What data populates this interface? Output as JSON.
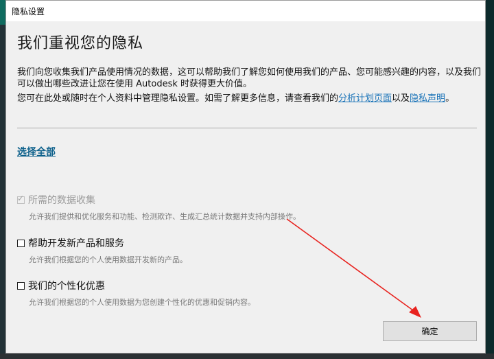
{
  "window": {
    "title": "隐私设置"
  },
  "main": {
    "heading": "我们重视您的隐私",
    "paragraph1": "我们向您收集我们产品使用情况的数据，这可以帮助我们了解您如何使用我们的产品、您可能感兴趣的内容，以及我们可以做出哪些改进让您在使用 Autodesk 时获得更大价值。",
    "paragraph2_prefix": "您可在此处或随时在个人资料中管理隐私设置。如需了解更多信息，请查看我们的",
    "link_analytics": "分析计划页面",
    "paragraph2_mid": "以及",
    "link_privacy": "隐私声明",
    "paragraph2_suffix": "。",
    "select_all": "选择全部"
  },
  "options": [
    {
      "label": "所需的数据收集",
      "description": "允许我们提供和优化服务和功能、检测欺诈、生成汇总统计数据并支持内部操作。",
      "checked": true,
      "disabled": true
    },
    {
      "label": "帮助开发新产品和服务",
      "description": "允许我们根据您的个人使用数据开发新的产品。",
      "checked": false,
      "disabled": false
    },
    {
      "label": "我们的个性化优惠",
      "description": "允许我们根据您的个人使用数据为您创建个性化的优惠和促销内容。",
      "checked": false,
      "disabled": false
    }
  ],
  "footer": {
    "ok_label": "确定"
  },
  "colors": {
    "link": "#1a73b8",
    "annotation_arrow": "#e8231f"
  },
  "icons": {
    "checkmark": "✓"
  }
}
